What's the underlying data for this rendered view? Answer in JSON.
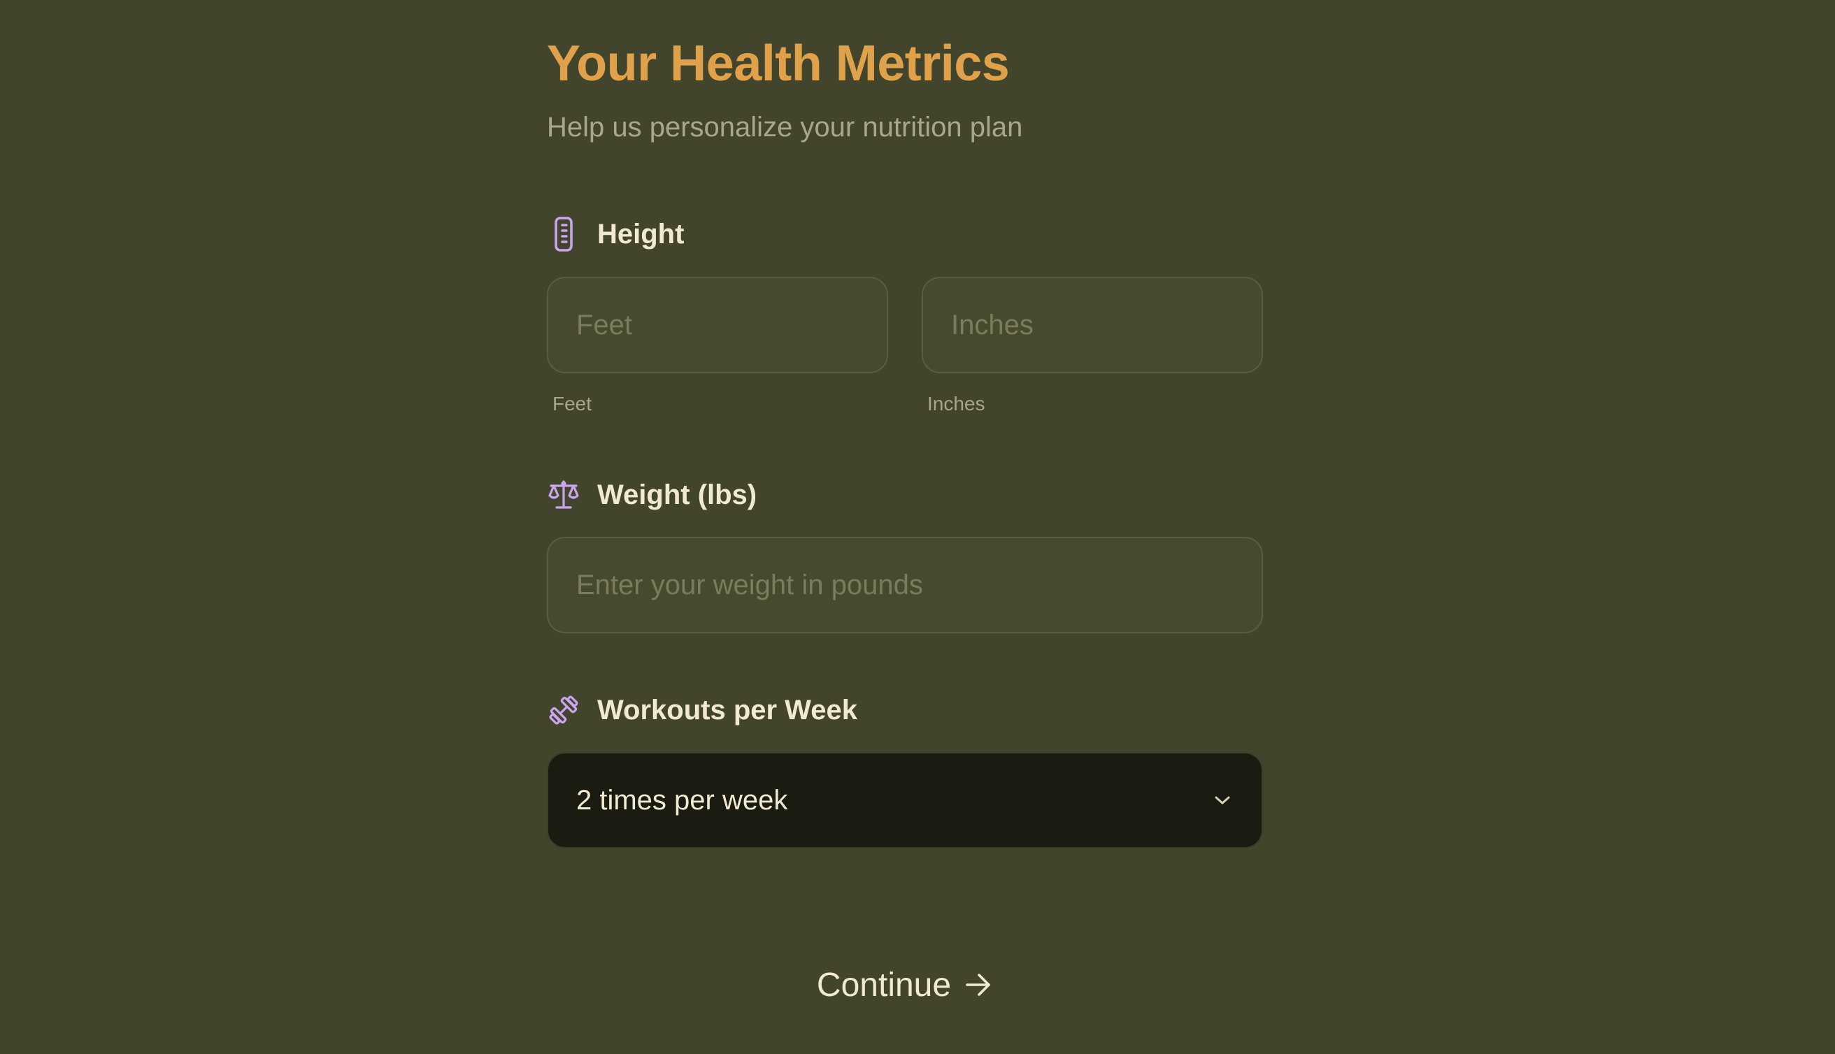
{
  "header": {
    "title": "Your Health Metrics",
    "subtitle": "Help us personalize your nutrition plan"
  },
  "height": {
    "label": "Height",
    "icon": "ruler-icon",
    "feet": {
      "placeholder": "Feet",
      "value": "",
      "caption": "Feet"
    },
    "inches": {
      "placeholder": "Inches",
      "value": "",
      "caption": "Inches"
    }
  },
  "weight": {
    "label": "Weight (lbs)",
    "icon": "scale-icon",
    "placeholder": "Enter your weight in pounds",
    "value": ""
  },
  "workouts": {
    "label": "Workouts per Week",
    "icon": "dumbbell-icon",
    "selected": "2 times per week"
  },
  "actions": {
    "continue_label": "Continue",
    "continue_icon": "arrow-right-icon"
  },
  "colors": {
    "background": "#42452b",
    "title": "#e0a14b",
    "icon_accent": "#c9a6ef",
    "text_primary": "#f1ead0",
    "text_muted": "#a9a68c",
    "select_background": "#1a1c12"
  }
}
